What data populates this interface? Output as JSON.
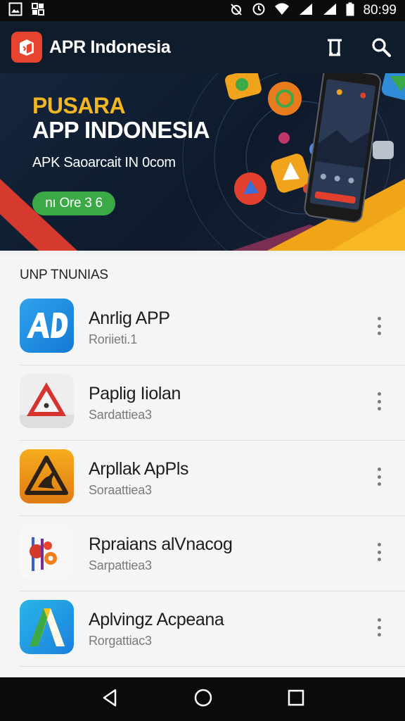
{
  "status_bar": {
    "time": "80:99",
    "left_icons": [
      "image-icon",
      "grid-icon"
    ],
    "right_icons": [
      "alarm-off-icon",
      "clock-icon",
      "wifi-icon",
      "signal-icon",
      "signal-icon",
      "battery-icon"
    ]
  },
  "app_bar": {
    "title": "APR Indonesia",
    "actions": [
      "bookmark-icon",
      "search-icon"
    ]
  },
  "banner": {
    "kicker": "PUSARA",
    "title": "APP INDONESIA",
    "subtitle": "APK Saoarcait IN 0com",
    "button_label": "nı Ore 3 6"
  },
  "list": {
    "section_title": "UNP TNUNIAS",
    "items": [
      {
        "name": "Anrlig APP",
        "subtitle": "Roriieti.1",
        "icon": "ad-app-icon"
      },
      {
        "name": "Paplig Iiolan",
        "subtitle": "Sardattiea3",
        "icon": "warning-triangle-app-icon"
      },
      {
        "name": "Arpllak ApPls",
        "subtitle": "Soraattiea3",
        "icon": "hazard-app-icon"
      },
      {
        "name": "Rpraians alVnacog",
        "subtitle": "Sarpattiea3",
        "icon": "gears-app-icon"
      },
      {
        "name": "Aplvingz Acpeana",
        "subtitle": "Rorgattiac3",
        "icon": "letter-a-app-icon"
      }
    ]
  },
  "colors": {
    "app_bar": "#0f1c2c",
    "accent_yellow": "#f0b722",
    "accent_green": "#3aa946",
    "accent_red": "#e8432e"
  },
  "nav_bar": [
    "back-icon",
    "home-icon",
    "recents-icon"
  ]
}
